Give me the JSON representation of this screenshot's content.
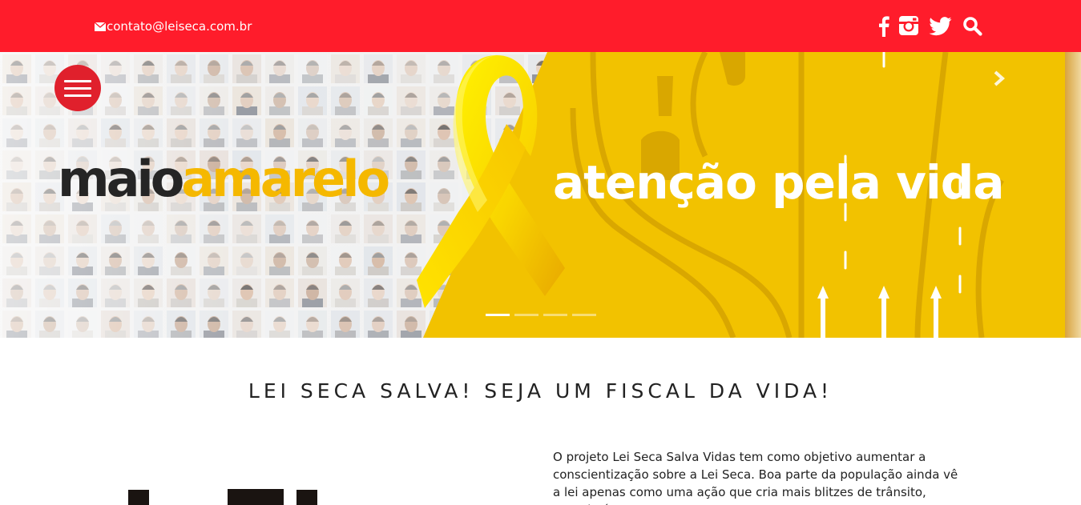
{
  "header": {
    "email": "contato@leiseca.com.br",
    "icons": [
      "mail-icon",
      "facebook-icon",
      "instagram-icon",
      "twitter-icon",
      "search-icon"
    ],
    "bar_color": "#ff1c2b"
  },
  "hero": {
    "word1": "maio",
    "word2": "amarelo",
    "tagline": "atenção pela vida",
    "slide_count": 4,
    "active_slide": 1,
    "colors": {
      "yellow": "#f2c200",
      "brand_yellow": "#f5b800",
      "dark": "#252525",
      "menu": "#e0202c"
    }
  },
  "main": {
    "title": "LEI SECA SALVA! SEJA UM FISCAL DA VIDA!",
    "intro": "O projeto Lei Seca Salva Vidas tem como objetivo aumentar a conscientização sobre a Lei Seca. Boa parte da população ainda vê a lei apenas como uma ação que cria mais blitzes de trânsito, quando é um"
  }
}
